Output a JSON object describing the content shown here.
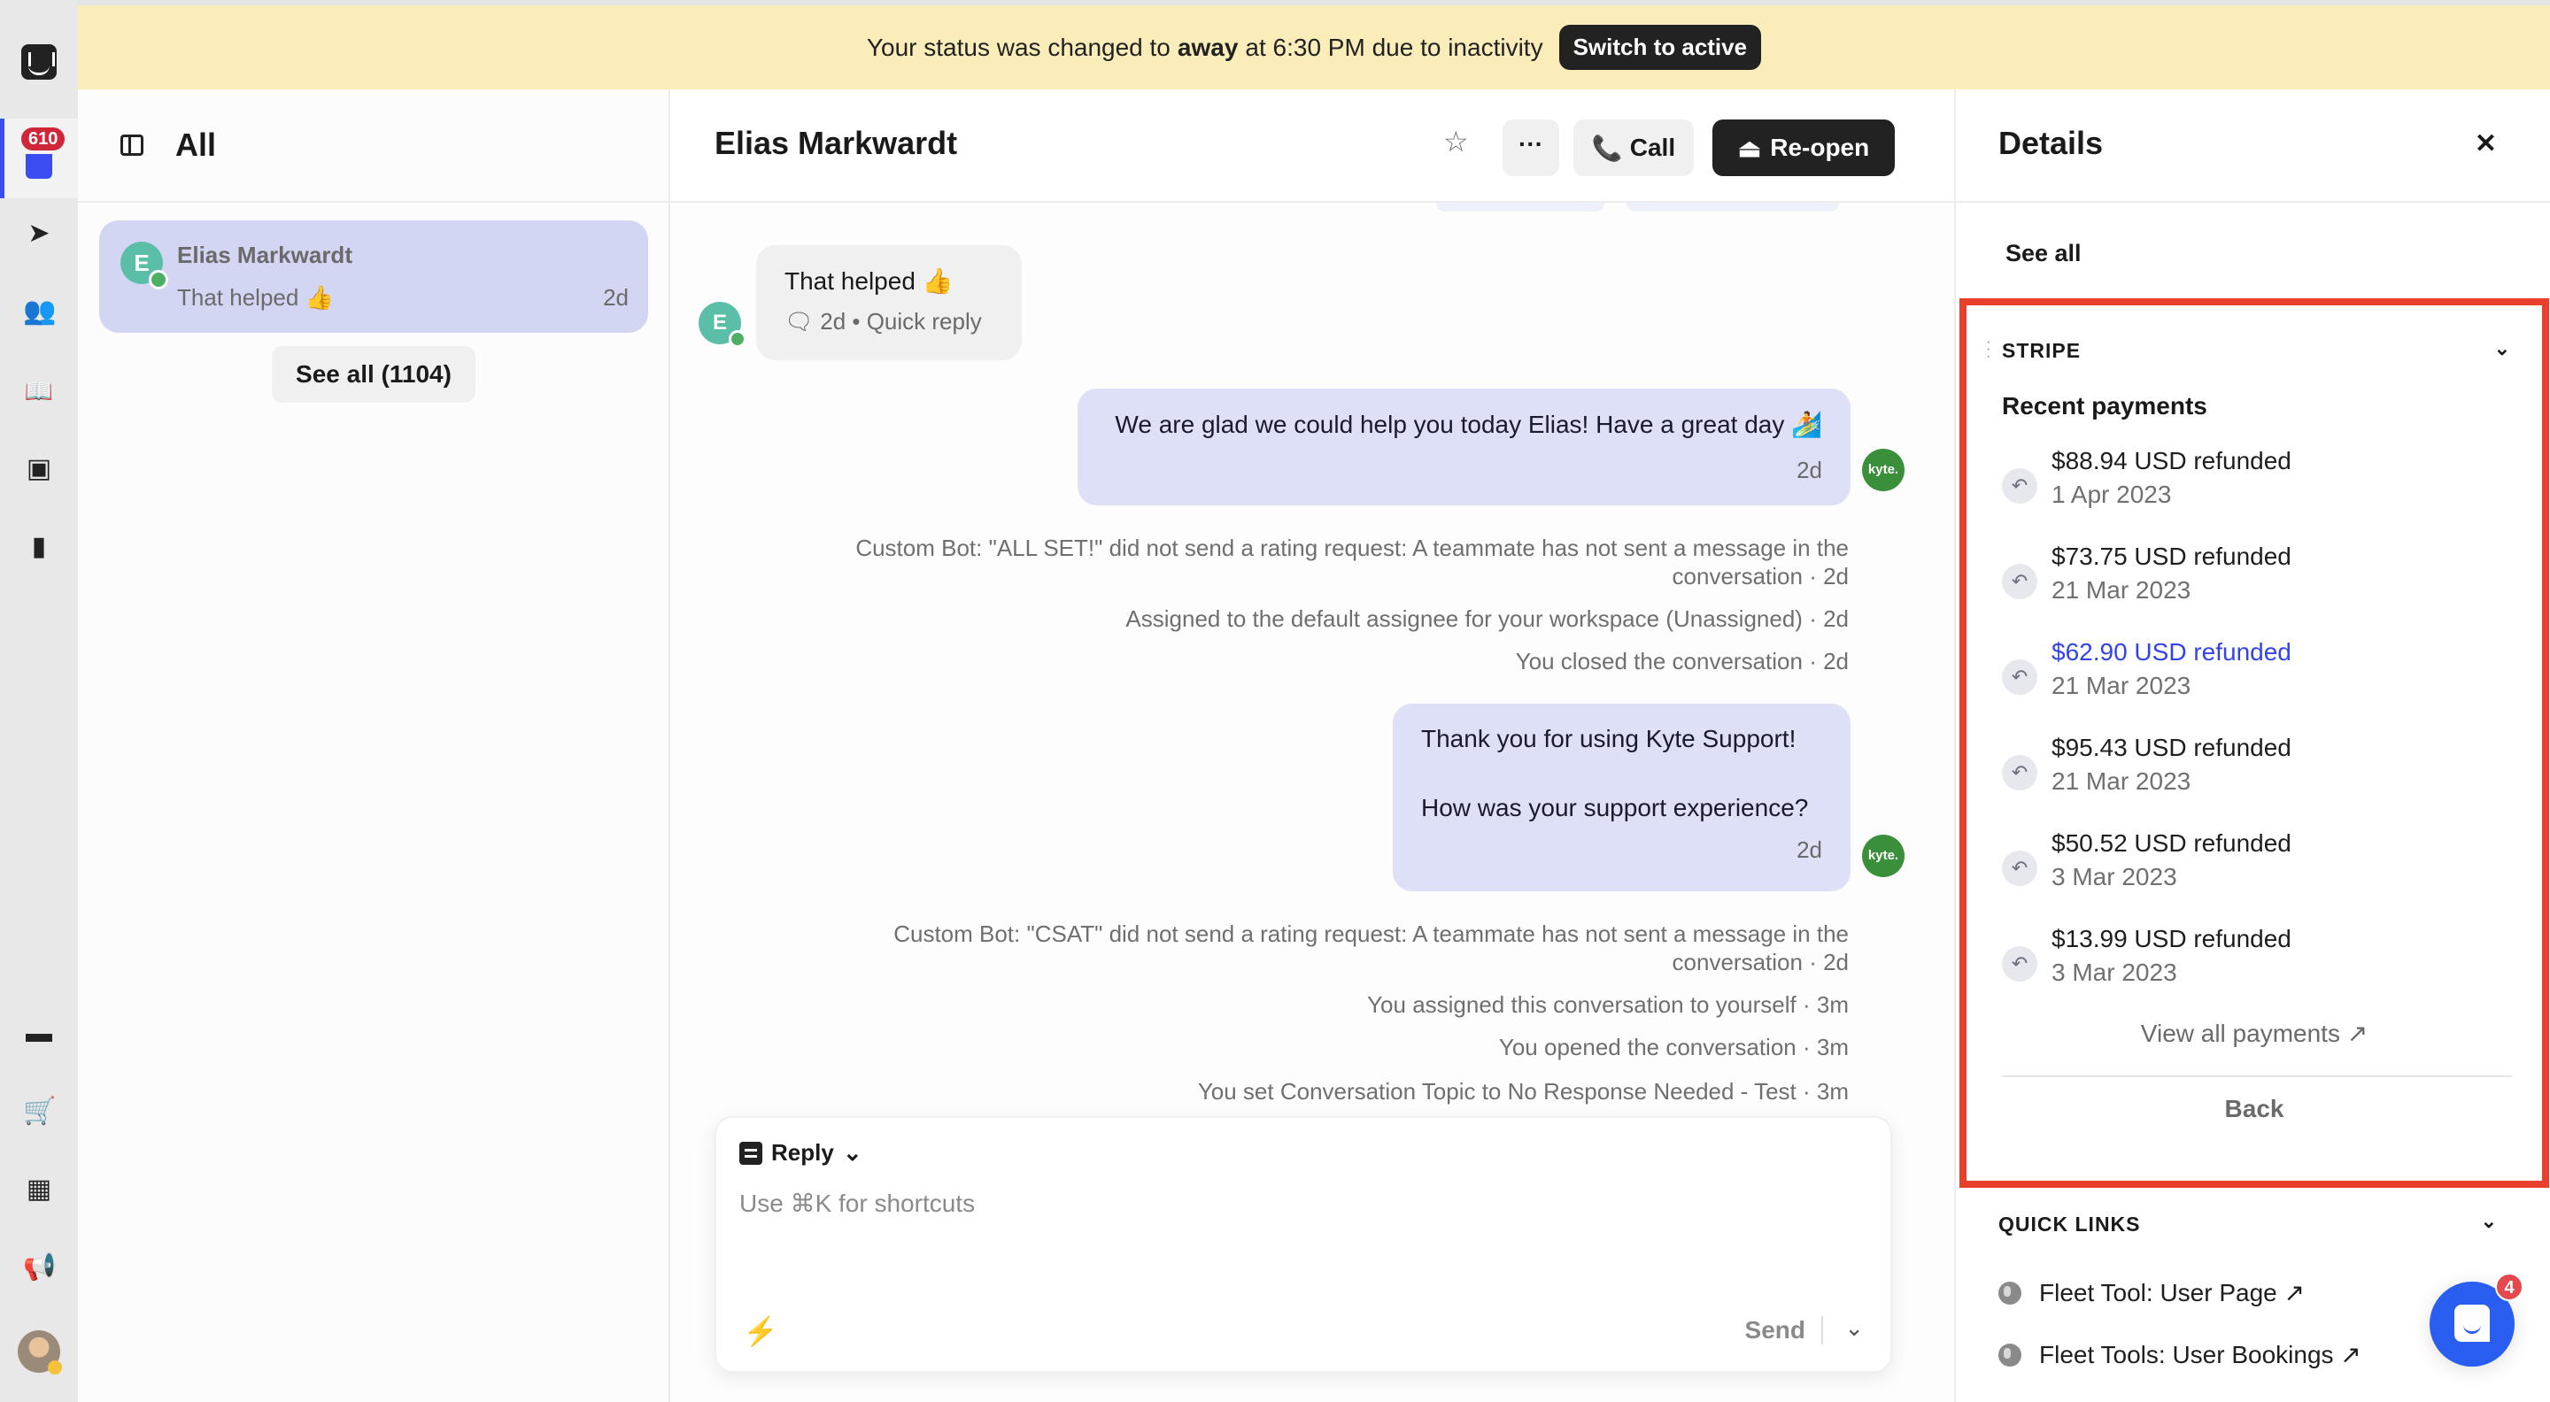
{
  "nav": {
    "inbox_badge": "610",
    "items": [
      {
        "icon": "intercom-logo-icon"
      },
      {
        "icon": "inbox-icon"
      },
      {
        "icon": "paper-plane-icon"
      },
      {
        "icon": "contacts-icon"
      },
      {
        "icon": "book-icon"
      },
      {
        "icon": "reports-box-icon"
      },
      {
        "icon": "bar-chart-icon"
      },
      {
        "icon": "messenger-icon"
      },
      {
        "icon": "cart-icon"
      },
      {
        "icon": "apps-grid-icon"
      },
      {
        "icon": "megaphone-icon"
      }
    ]
  },
  "banner": {
    "text_before": "Your status was changed to",
    "status": "away",
    "text_after": "at 6:30 PM due to inactivity",
    "button": "Switch to active"
  },
  "inbox": {
    "title": "All",
    "conversations": [
      {
        "initial": "E",
        "name": "Elias Markwardt",
        "preview": "That helped 👍",
        "time": "2d"
      }
    ],
    "see_all": "See all (1104)"
  },
  "conversation": {
    "title": "Elias Markwardt",
    "actions": {
      "call": "Call",
      "reopen": "Re-open",
      "more": "···"
    },
    "messages": [
      {
        "from": "user",
        "initial": "E",
        "text": "That helped 👍",
        "meta": "2d • Quick reply"
      },
      {
        "from": "agent",
        "avatar": "kyte.",
        "text": "We are glad we could help you today Elias! Have a great day 🏄",
        "meta": "2d"
      }
    ],
    "events_1": [
      {
        "text": "Custom Bot: \"ALL SET!\" did not send a rating request: A teammate has not sent a message in the conversation",
        "time": "2d"
      },
      {
        "text": "Assigned to the default assignee for your workspace (Unassigned)",
        "time": "2d"
      },
      {
        "text": "You closed the conversation",
        "time": "2d"
      }
    ],
    "csat_message": {
      "from": "agent",
      "avatar": "kyte.",
      "line1": "Thank you for using Kyte Support!",
      "line2": "How was your support experience?",
      "meta": "2d"
    },
    "events_2": [
      {
        "text": "Custom Bot: \"CSAT\" did not send a rating request: A teammate has not sent a message in the conversation",
        "time": "2d"
      },
      {
        "text": "You assigned this conversation to yourself",
        "time": "3m"
      },
      {
        "text": "You opened the conversation",
        "time": "3m"
      },
      {
        "text": "You set Conversation Topic to No Response Needed - Test",
        "time": "3m"
      }
    ],
    "composer": {
      "mode": "Reply",
      "placeholder": "Use ⌘K for shortcuts",
      "send": "Send"
    }
  },
  "details": {
    "title": "Details",
    "see_all": "See all",
    "stripe": {
      "label": "STRIPE",
      "subtitle": "Recent payments",
      "payments": [
        {
          "amount": "$88.94 USD refunded",
          "date": "1 Apr 2023",
          "highlighted": false
        },
        {
          "amount": "$73.75 USD refunded",
          "date": "21 Mar 2023",
          "highlighted": false
        },
        {
          "amount": "$62.90 USD refunded",
          "date": "21 Mar 2023",
          "highlighted": true
        },
        {
          "amount": "$95.43 USD refunded",
          "date": "21 Mar 2023",
          "highlighted": false
        },
        {
          "amount": "$50.52 USD refunded",
          "date": "3 Mar 2023",
          "highlighted": false
        },
        {
          "amount": "$13.99 USD refunded",
          "date": "3 Mar 2023",
          "highlighted": false
        }
      ],
      "view_all": "View all payments ↗",
      "back": "Back"
    },
    "quick_links": {
      "label": "QUICK LINKS",
      "items": [
        {
          "label": "Fleet Tool: User Page ↗"
        },
        {
          "label": "Fleet Tools: User Bookings ↗"
        }
      ]
    }
  },
  "messenger_launcher": {
    "count": "4"
  },
  "colors": {
    "accent": "#3b4cf0",
    "banner_bg": "#fbedba",
    "highlight_box": "#e8402a",
    "link_blue": "#3344e6",
    "selected_conv": "#d3d6f3",
    "agent_bubble": "#dde0f6"
  }
}
